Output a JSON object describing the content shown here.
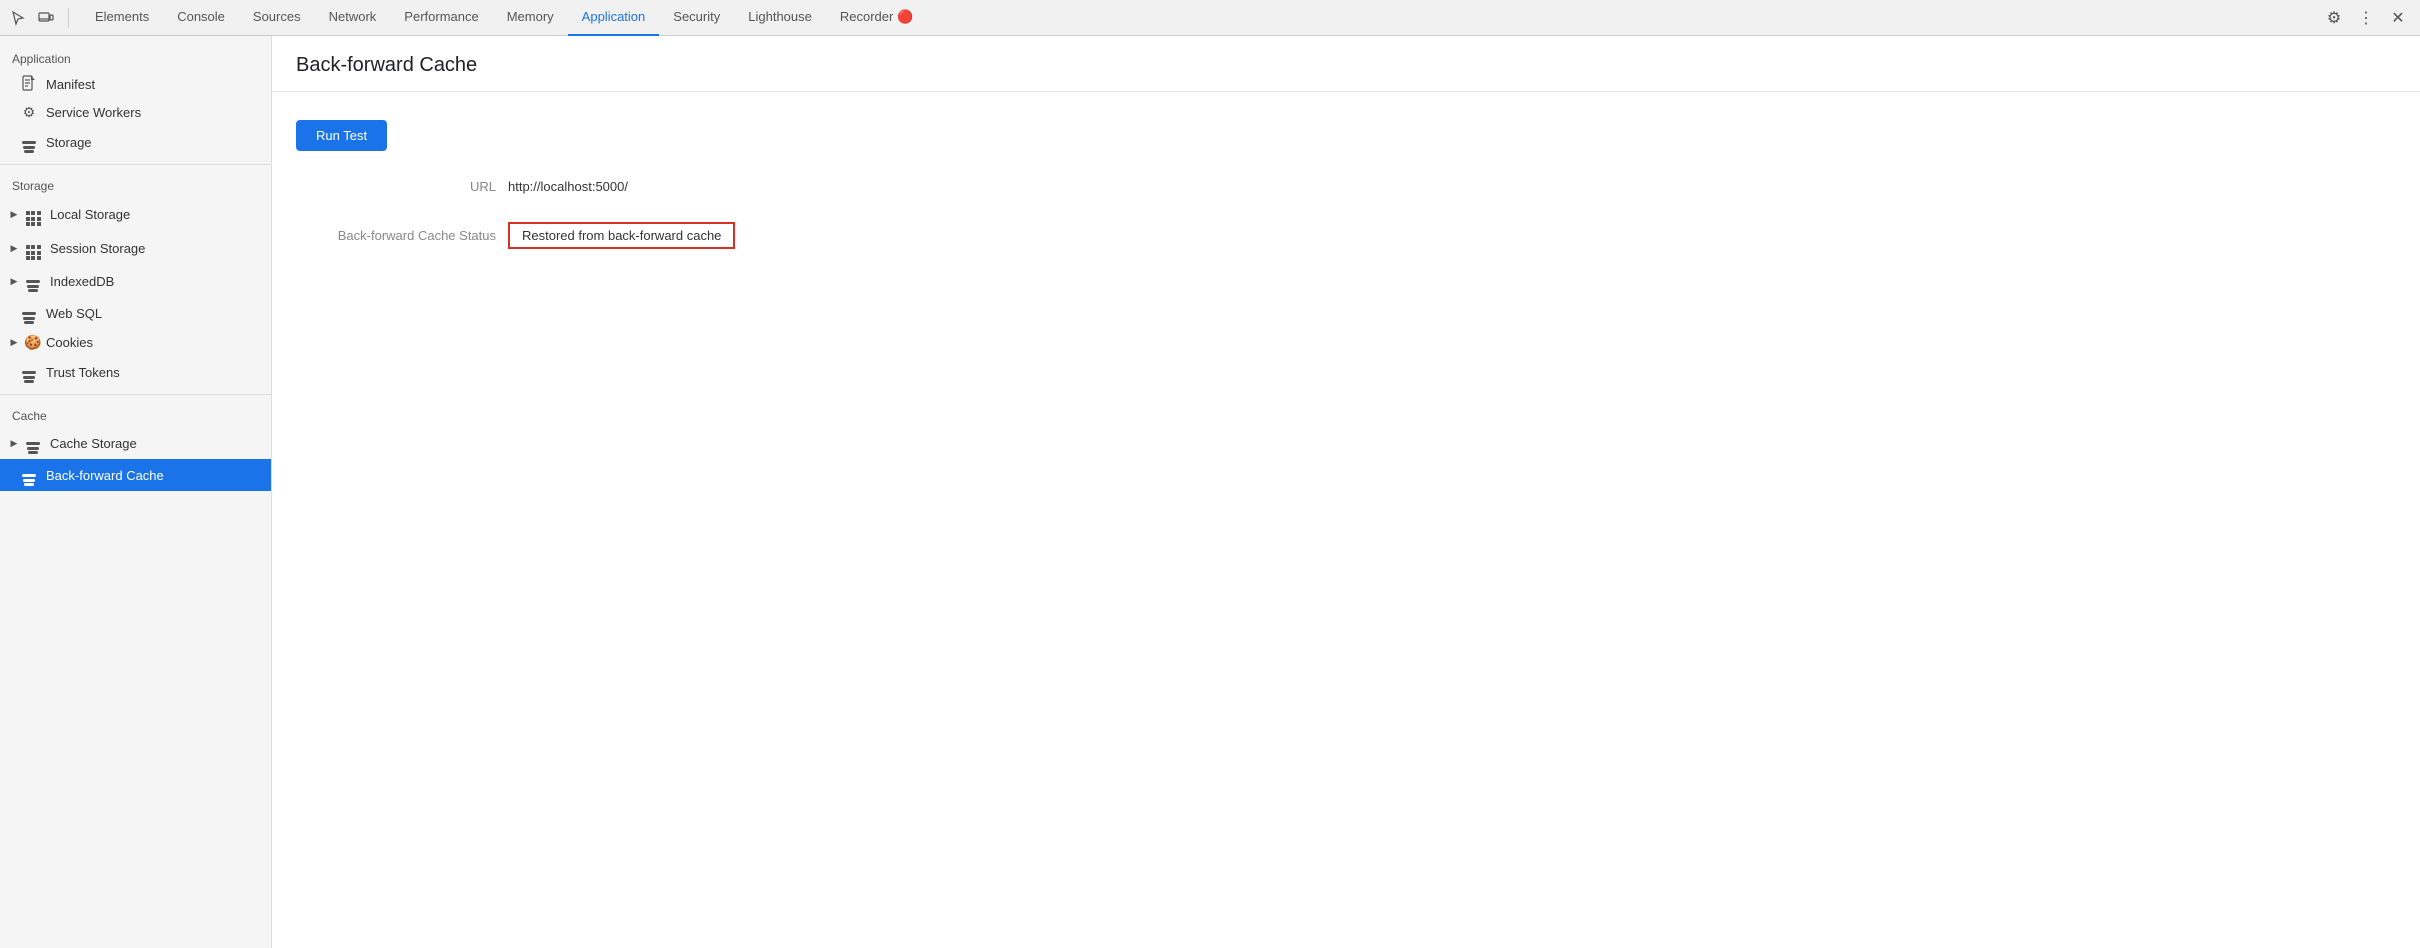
{
  "tabbar": {
    "tabs": [
      {
        "label": "Elements",
        "active": false
      },
      {
        "label": "Console",
        "active": false
      },
      {
        "label": "Sources",
        "active": false
      },
      {
        "label": "Network",
        "active": false
      },
      {
        "label": "Performance",
        "active": false
      },
      {
        "label": "Memory",
        "active": false
      },
      {
        "label": "Application",
        "active": true
      },
      {
        "label": "Security",
        "active": false
      },
      {
        "label": "Lighthouse",
        "active": false
      },
      {
        "label": "Recorder 🔴",
        "active": false
      }
    ]
  },
  "sidebar": {
    "section_application": "Application",
    "manifest_label": "Manifest",
    "service_workers_label": "Service Workers",
    "storage_label": "Storage",
    "section_storage": "Storage",
    "local_storage_label": "Local Storage",
    "session_storage_label": "Session Storage",
    "indexed_db_label": "IndexedDB",
    "web_sql_label": "Web SQL",
    "cookies_label": "Cookies",
    "trust_tokens_label": "Trust Tokens",
    "section_cache": "Cache",
    "cache_storage_label": "Cache Storage",
    "back_forward_cache_label": "Back-forward Cache"
  },
  "content": {
    "title": "Back-forward Cache",
    "run_test_button": "Run Test",
    "url_label": "URL",
    "url_value": "http://localhost:5000/",
    "cache_status_label": "Back-forward Cache Status",
    "cache_status_value": "Restored from back-forward cache"
  }
}
